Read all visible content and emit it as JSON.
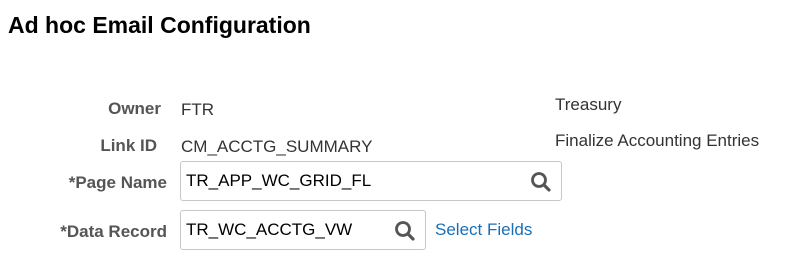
{
  "page": {
    "title": "Ad hoc Email Configuration"
  },
  "form": {
    "owner": {
      "label": "Owner",
      "value": "FTR",
      "description": "Treasury"
    },
    "link_id": {
      "label": "Link ID",
      "value": "CM_ACCTG_SUMMARY",
      "description": "Finalize Accounting Entries"
    },
    "page_name": {
      "label": "*Page Name",
      "value": "TR_APP_WC_GRID_FL",
      "icon": "search-icon"
    },
    "data_record": {
      "label": "*Data Record",
      "value": "TR_WC_ACCTG_VW",
      "icon": "search-icon",
      "link_label": "Select Fields"
    }
  },
  "colors": {
    "link": "#1a6fb5",
    "label": "#555555",
    "border": "#c7c7c7"
  }
}
